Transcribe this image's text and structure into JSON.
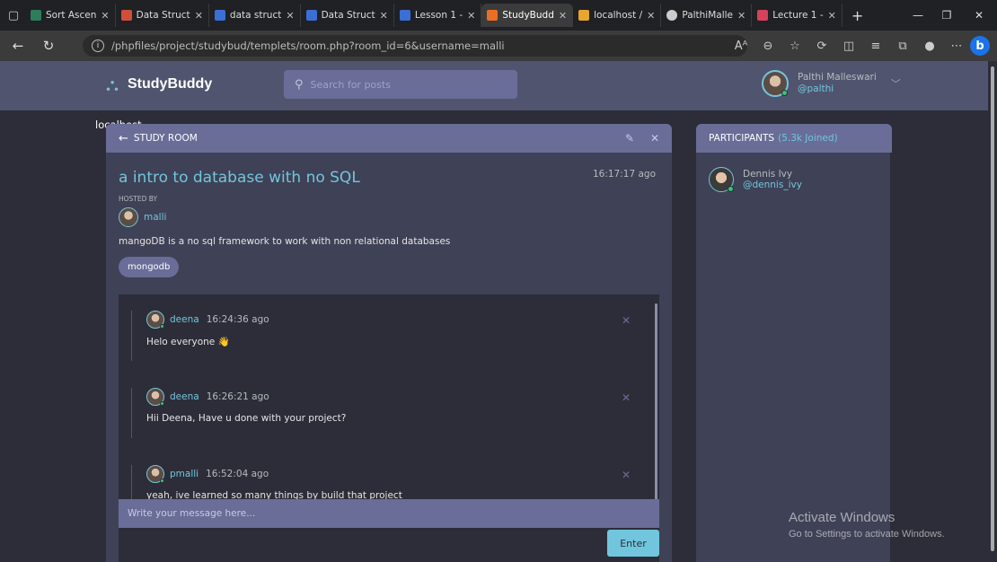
{
  "browser": {
    "tabs": [
      {
        "label": "Sort Ascen",
        "color": "#2e7d5b",
        "active": false
      },
      {
        "label": "Data Struct",
        "color": "#d14f3a",
        "active": false
      },
      {
        "label": "data struct",
        "color": "#3b6fd6",
        "active": false
      },
      {
        "label": "Data Struct",
        "color": "#3b6fd6",
        "active": false
      },
      {
        "label": "Lesson 1 -",
        "color": "#3b6fd6",
        "active": false
      },
      {
        "label": "StudyBudd",
        "color": "#e86f25",
        "active": true
      },
      {
        "label": "localhost /",
        "color": "#e8a530",
        "active": false
      },
      {
        "label": "PalthiMalle",
        "color": "#cccccc",
        "active": false
      },
      {
        "label": "Lecture 1 -",
        "color": "#d6415c",
        "active": false
      }
    ],
    "url_host": "localhost",
    "url_path": "/phpfiles/project/studybud/templets/room.php?room_id=6&username=malli"
  },
  "header": {
    "brand": "StudyBuddy",
    "search_placeholder": "Search for posts",
    "user_name": "Palthi Malleswari",
    "user_handle": "@palthi"
  },
  "room": {
    "header_label": "STUDY ROOM",
    "title": "a intro to database with no SQL",
    "time": "16:17:17 ago",
    "hosted_label": "HOSTED BY",
    "host_name": "malli",
    "description": "mangoDB is a no sql framework to work with non relational databases",
    "topic": "mongodb"
  },
  "messages": [
    {
      "user": "deena",
      "time": "16:24:36 ago",
      "text": "Helo everyone 👋"
    },
    {
      "user": "deena",
      "time": "16:26:21 ago",
      "text": "Hii Deena, Have u done with your project?"
    },
    {
      "user": "pmalli",
      "time": "16:52:04 ago",
      "text": "yeah, ive learned so many things by build that project"
    }
  ],
  "compose": {
    "placeholder": "Write your message here...",
    "enter_label": "Enter"
  },
  "participants": {
    "title": "PARTICIPANTS",
    "joined": "(5.3k Joined)",
    "list": [
      {
        "name": "Dennis Ivy",
        "handle": "@dennis_ivy"
      }
    ]
  },
  "watermark": {
    "line1": "Activate Windows",
    "line2": "Go to Settings to activate Windows."
  },
  "colors": {
    "accent": "#71c6dd",
    "panel": "#3f4156",
    "header": "#696d97",
    "background": "#2d2d39"
  }
}
